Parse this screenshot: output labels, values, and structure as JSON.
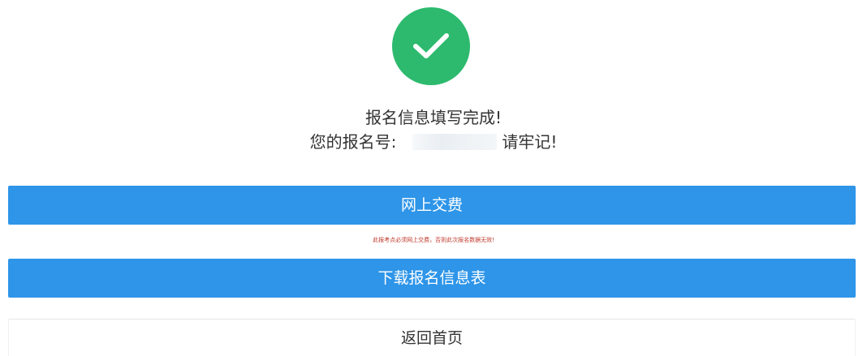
{
  "status": {
    "icon": "check-circle-icon",
    "accent_color": "#2dba6e"
  },
  "message": {
    "title": "报名信息填写完成!",
    "number_prefix": "您的报名号:",
    "number_suffix": "请牢记!"
  },
  "actions": {
    "pay_label": "网上交费",
    "payment_notice": "此报考点必须网上交费，否则此次报名数据无效!",
    "download_label": "下载报名信息表",
    "home_label": "返回首页",
    "primary_color": "#2e95e8"
  }
}
